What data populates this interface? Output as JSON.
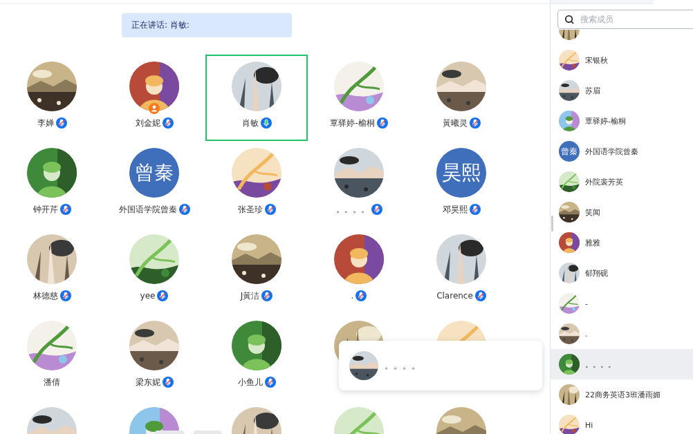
{
  "speaking_banner": {
    "text": "正在讲话: 肖敏:"
  },
  "members": [
    {
      "name": "李婵",
      "mic_shown": true,
      "mic_muted": true,
      "host": false,
      "selected": false,
      "avatar": {
        "kind": "picture"
      }
    },
    {
      "name": "刘金妮",
      "mic_shown": true,
      "mic_muted": true,
      "host": true,
      "selected": false,
      "avatar": {
        "kind": "picture"
      }
    },
    {
      "name": "肖敏",
      "mic_shown": true,
      "mic_muted": false,
      "host": false,
      "selected": true,
      "avatar": {
        "kind": "picture"
      }
    },
    {
      "name": "覃驿婷-榆桐",
      "mic_shown": true,
      "mic_muted": true,
      "host": false,
      "selected": false,
      "avatar": {
        "kind": "picture"
      }
    },
    {
      "name": "黃曦灵",
      "mic_shown": true,
      "mic_muted": true,
      "host": false,
      "selected": false,
      "avatar": {
        "kind": "picture"
      }
    },
    {
      "name": "钟开芹",
      "mic_shown": true,
      "mic_muted": true,
      "host": false,
      "selected": false,
      "avatar": {
        "kind": "picture"
      }
    },
    {
      "name": "外国语学院曾秦",
      "mic_shown": true,
      "mic_muted": true,
      "host": false,
      "selected": false,
      "avatar": {
        "kind": "initials",
        "text": "曾秦"
      }
    },
    {
      "name": "张圣珍",
      "mic_shown": true,
      "mic_muted": true,
      "host": false,
      "selected": false,
      "avatar": {
        "kind": "picture"
      }
    },
    {
      "name": "。。。。",
      "mic_shown": true,
      "mic_muted": true,
      "host": false,
      "selected": false,
      "avatar": {
        "kind": "picture"
      }
    },
    {
      "name": "邓昊熙",
      "mic_shown": true,
      "mic_muted": true,
      "host": false,
      "selected": false,
      "avatar": {
        "kind": "initials",
        "text": "昊熙"
      }
    },
    {
      "name": "林德慈",
      "mic_shown": true,
      "mic_muted": true,
      "host": false,
      "selected": false,
      "avatar": {
        "kind": "picture"
      }
    },
    {
      "name": "yee",
      "mic_shown": true,
      "mic_muted": true,
      "host": false,
      "selected": false,
      "avatar": {
        "kind": "picture"
      }
    },
    {
      "name": "J黃洁",
      "mic_shown": true,
      "mic_muted": true,
      "host": false,
      "selected": false,
      "avatar": {
        "kind": "picture"
      }
    },
    {
      "name": ".",
      "mic_shown": true,
      "mic_muted": true,
      "host": false,
      "selected": false,
      "avatar": {
        "kind": "picture"
      }
    },
    {
      "name": "Clarence",
      "mic_shown": true,
      "mic_muted": true,
      "host": false,
      "selected": false,
      "avatar": {
        "kind": "picture"
      }
    },
    {
      "name": "潘倩",
      "mic_shown": false,
      "host": false,
      "selected": false,
      "avatar": {
        "kind": "picture"
      }
    },
    {
      "name": "梁东妮",
      "mic_shown": true,
      "mic_muted": true,
      "host": false,
      "selected": false,
      "avatar": {
        "kind": "picture"
      }
    },
    {
      "name": "小鱼儿",
      "mic_shown": true,
      "mic_muted": true,
      "host": false,
      "selected": false,
      "avatar": {
        "kind": "picture"
      }
    },
    {
      "avatar": {
        "kind": "picture"
      }
    },
    {
      "avatar": {
        "kind": "picture"
      }
    },
    {
      "avatar": {
        "kind": "picture"
      }
    },
    {
      "avatar": {
        "kind": "picture"
      }
    },
    {
      "avatar": {
        "kind": "picture"
      }
    },
    {
      "avatar": {
        "kind": "picture"
      }
    },
    {
      "avatar": {
        "kind": "picture"
      }
    }
  ],
  "popup": {
    "name": "。。。。",
    "avatar": {
      "kind": "picture"
    }
  },
  "sidebar": {
    "search": {
      "placeholder": "搜索成员"
    },
    "items": [
      {
        "selected": false,
        "avatar": {
          "kind": "picture"
        }
      },
      {
        "name": "宋银秋",
        "selected": false,
        "avatar": {
          "kind": "picture"
        }
      },
      {
        "name": "苏眉",
        "selected": false,
        "avatar": {
          "kind": "picture"
        }
      },
      {
        "name": "覃驿婷-榆桐",
        "selected": false,
        "avatar": {
          "kind": "picture"
        }
      },
      {
        "name": "外国语学院曾秦",
        "selected": false,
        "avatar": {
          "kind": "initials",
          "text": "曾秦"
        }
      },
      {
        "name": "外院裴芳英",
        "selected": false,
        "avatar": {
          "kind": "picture"
        }
      },
      {
        "name": "笑闻",
        "selected": false,
        "avatar": {
          "kind": "picture"
        }
      },
      {
        "name": "雅雅",
        "selected": false,
        "avatar": {
          "kind": "picture"
        }
      },
      {
        "name": "郁翔砚",
        "selected": false,
        "avatar": {
          "kind": "picture"
        }
      },
      {
        "name": "-",
        "selected": false,
        "avatar": {
          "kind": "picture"
        }
      },
      {
        "name": ".",
        "selected": false,
        "avatar": {
          "kind": "picture"
        }
      },
      {
        "name": "。。。。",
        "selected": true,
        "avatar": {
          "kind": "picture"
        }
      },
      {
        "name": "22商务英语3班潘雨媚",
        "selected": false,
        "avatar": {
          "kind": "picture"
        }
      },
      {
        "name": "Hi",
        "selected": false,
        "avatar": {
          "kind": "picture"
        }
      }
    ]
  }
}
